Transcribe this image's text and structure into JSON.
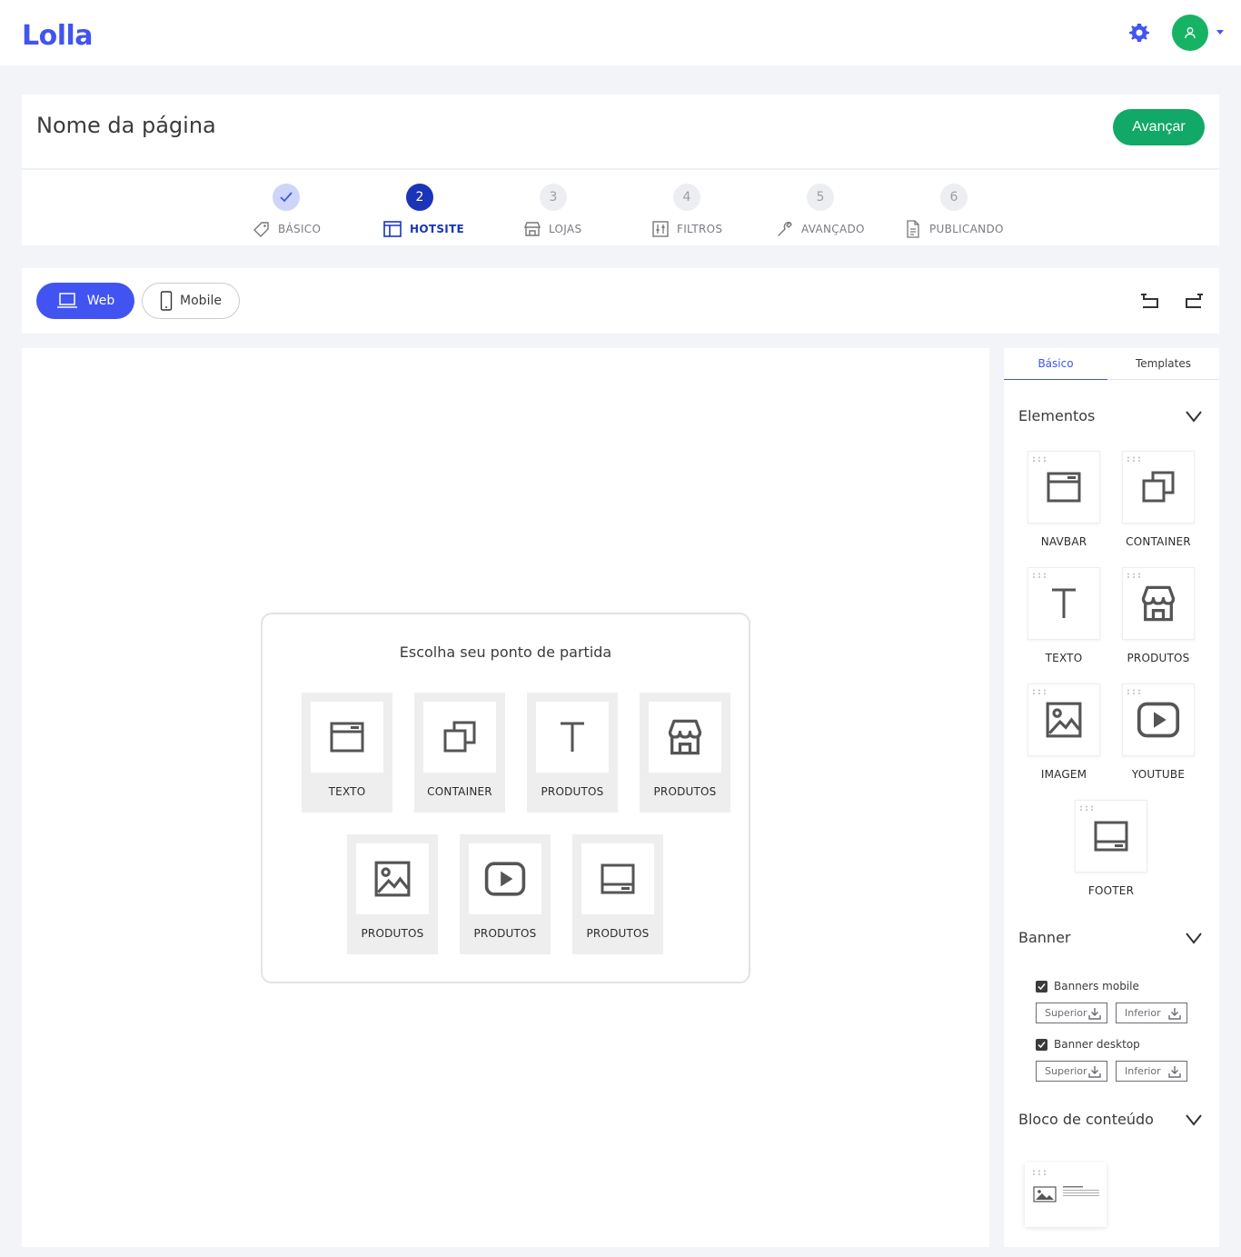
{
  "app": {
    "logo": "Lolla"
  },
  "header": {
    "page_title": "Nome da página",
    "advance_label": "Avançar"
  },
  "steps": [
    {
      "num": "",
      "label": "BÁSICO",
      "state": "done",
      "icon": "tag-icon"
    },
    {
      "num": "2",
      "label": "HOTSITE",
      "state": "active",
      "icon": "layout-icon"
    },
    {
      "num": "3",
      "label": "LOJAS",
      "state": "pending",
      "icon": "store-icon"
    },
    {
      "num": "4",
      "label": "FILTROS",
      "state": "pending",
      "icon": "sliders-icon"
    },
    {
      "num": "5",
      "label": "AVANÇADO",
      "state": "pending",
      "icon": "wrench-icon"
    },
    {
      "num": "6",
      "label": "PUBLICANDO",
      "state": "pending",
      "icon": "document-icon"
    }
  ],
  "toolbar": {
    "web_label": "Web",
    "mobile_label": "Mobile"
  },
  "start": {
    "title": "Escolha seu ponto de partida",
    "tiles": [
      {
        "label": "TEXTO",
        "icon": "navbar-icon"
      },
      {
        "label": "CONTAINER",
        "icon": "container-icon"
      },
      {
        "label": "PRODUTOS",
        "icon": "text-icon"
      },
      {
        "label": "PRODUTOS",
        "icon": "store-icon"
      },
      {
        "label": "PRODUTOS",
        "icon": "image-icon"
      },
      {
        "label": "PRODUTOS",
        "icon": "youtube-icon"
      },
      {
        "label": "PRODUTOS",
        "icon": "footer-icon"
      }
    ]
  },
  "panel": {
    "tabs": {
      "basic": "Básico",
      "templates": "Templates"
    },
    "elements_title": "Elementos",
    "elements": [
      {
        "label": "NAVBAR",
        "icon": "navbar-icon"
      },
      {
        "label": "CONTAINER",
        "icon": "container-icon"
      },
      {
        "label": "TEXTO",
        "icon": "text-icon"
      },
      {
        "label": "PRODUTOS",
        "icon": "store-icon"
      },
      {
        "label": "IMAGEM",
        "icon": "image-icon"
      },
      {
        "label": "YOUTUBE",
        "icon": "youtube-icon"
      },
      {
        "label": "FOOTER",
        "icon": "footer-icon"
      }
    ],
    "banner_title": "Banner",
    "banners": [
      {
        "label": "Banners mobile",
        "checked": true,
        "top": "Superior",
        "bottom": "Inferior"
      },
      {
        "label": "Banner desktop",
        "checked": true,
        "top": "Superior",
        "bottom": "Inferior"
      }
    ],
    "content_block_title": "Bloco de conteúdo"
  },
  "colors": {
    "accent": "#4154f1",
    "active_step": "#1a35b8",
    "success": "#12a867"
  }
}
